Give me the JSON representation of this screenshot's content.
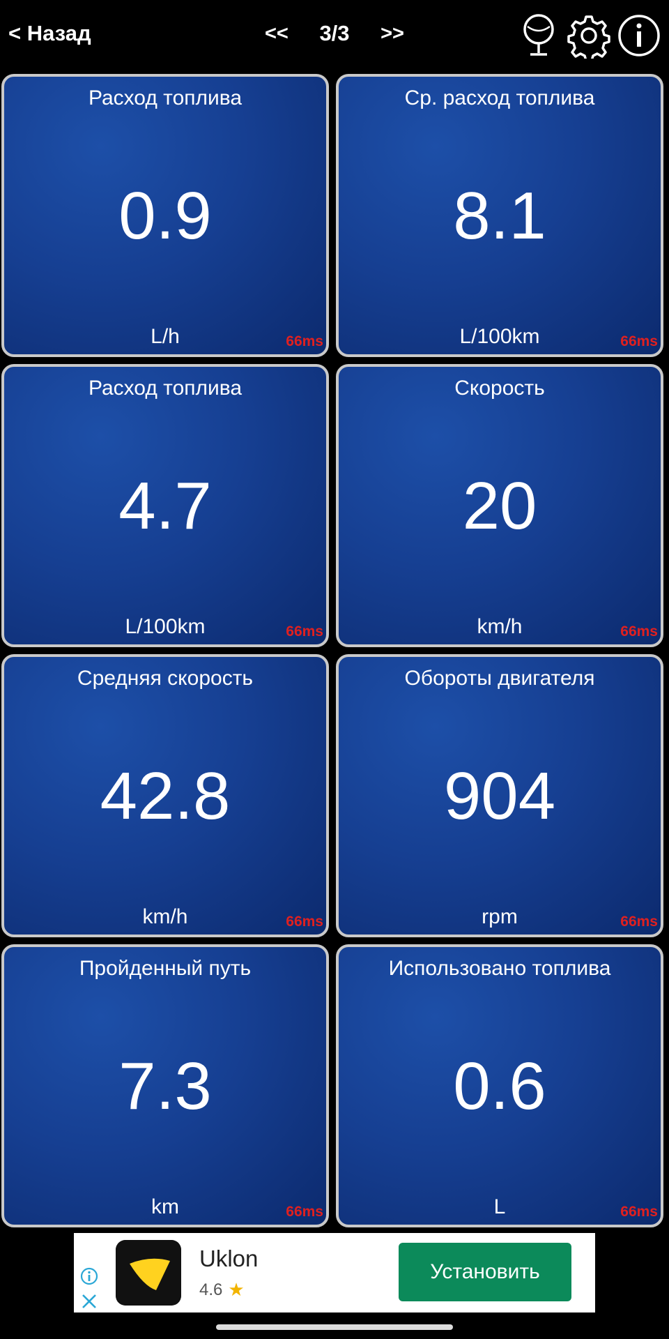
{
  "header": {
    "back_label": "< Назад",
    "prev_label": "<<",
    "page_indicator": "3/3",
    "next_label": ">>",
    "icons": [
      "map-pin-icon",
      "gear-icon",
      "info-icon"
    ]
  },
  "tiles": [
    {
      "title": "Расход топлива",
      "value": "0.9",
      "unit": "L/h",
      "latency": "66ms"
    },
    {
      "title": "Ср. расход топлива",
      "value": "8.1",
      "unit": "L/100km",
      "latency": "66ms"
    },
    {
      "title": "Расход топлива",
      "value": "4.7",
      "unit": "L/100km",
      "latency": "66ms"
    },
    {
      "title": "Скорость",
      "value": "20",
      "unit": "km/h",
      "latency": "66ms"
    },
    {
      "title": "Средняя скорость",
      "value": "42.8",
      "unit": "km/h",
      "latency": "66ms"
    },
    {
      "title": "Обороты двигателя",
      "value": "904",
      "unit": "rpm",
      "latency": "66ms"
    },
    {
      "title": "Пройденный путь",
      "value": "7.3",
      "unit": "km",
      "latency": "66ms"
    },
    {
      "title": "Использовано топлива",
      "value": "0.6",
      "unit": "L",
      "latency": "66ms"
    }
  ],
  "ad": {
    "app_name": "Uklon",
    "rating": "4.6",
    "install_label": "Установить",
    "logo_color": "#ffd21f"
  },
  "colors": {
    "tile_background": "#163f92",
    "tile_border": "#c9c9c9",
    "latency": "#e0201f",
    "install_button": "#0c8a5a"
  }
}
